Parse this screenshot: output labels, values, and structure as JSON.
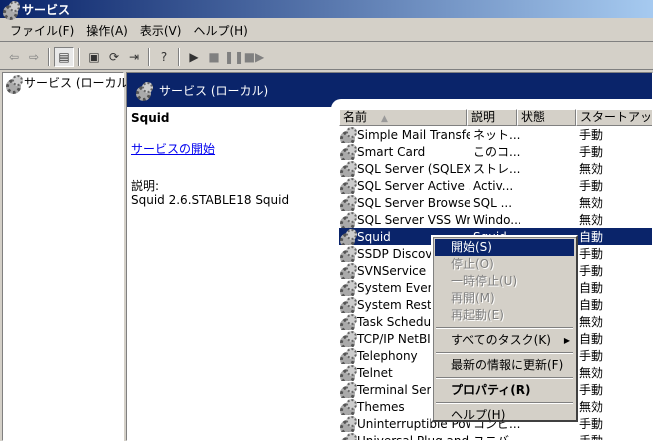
{
  "window": {
    "title": "サービス"
  },
  "menu": [
    "ファイル(F)",
    "操作(A)",
    "表示(V)",
    "ヘルプ(H)"
  ],
  "toolbar": {
    "back": "⇦",
    "forward": "⇨",
    "show_tree": "▤",
    "properties": "▣",
    "refresh": "⟳",
    "export": "⇥",
    "help": "?",
    "start": "▶",
    "stop": "■",
    "pause": "❚❚",
    "restart": "■▶"
  },
  "tree": {
    "root_label": "サービス (ローカル)"
  },
  "header": {
    "title": "サービス (ローカル)"
  },
  "detail": {
    "service_name": "Squid",
    "start_link": "サービスの開始",
    "description_label": "説明:",
    "description": "Squid 2.6.STABLE18 Squid"
  },
  "columns": {
    "name": "名前",
    "description": "説明",
    "status": "状態",
    "startup": "スタートアップの種"
  },
  "services": [
    {
      "name": "Simple Mail Transfe...",
      "description": "ネット...",
      "status": "",
      "startup": "手動"
    },
    {
      "name": "Smart Card",
      "description": "このコ...",
      "status": "",
      "startup": "手動"
    },
    {
      "name": "SQL Server (SQLEX...",
      "description": "ストレ...",
      "status": "",
      "startup": "無効"
    },
    {
      "name": "SQL Server Active ...",
      "description": "Activ...",
      "status": "",
      "startup": "手動"
    },
    {
      "name": "SQL Server Browser",
      "description": "SQL ...",
      "status": "",
      "startup": "無効"
    },
    {
      "name": "SQL Server VSS Wr...",
      "description": "Windo...",
      "status": "",
      "startup": "無効"
    },
    {
      "name": "Squid",
      "description": "Squid ...",
      "status": "",
      "startup": "自動"
    },
    {
      "name": "SSDP Discovery Service",
      "description": "",
      "status": "",
      "startup": "手動"
    },
    {
      "name": "SVNService",
      "description": "",
      "status": "",
      "startup": "手動"
    },
    {
      "name": "System Event Notification",
      "description": "",
      "status": "",
      "startup": "自動"
    },
    {
      "name": "System Restore Service",
      "description": "",
      "status": "",
      "startup": "自動"
    },
    {
      "name": "Task Scheduler",
      "description": "",
      "status": "",
      "startup": "無効"
    },
    {
      "name": "TCP/IP NetBIOS Helper",
      "description": "",
      "status": "",
      "startup": "自動"
    },
    {
      "name": "Telephony",
      "description": "",
      "status": "",
      "startup": "手動"
    },
    {
      "name": "Telnet",
      "description": "",
      "status": "",
      "startup": "無効"
    },
    {
      "name": "Terminal Services",
      "description": "",
      "status": "",
      "startup": "手動"
    },
    {
      "name": "Themes",
      "description": "",
      "status": "",
      "startup": "無効"
    },
    {
      "name": "Uninterruptible Pow...",
      "description": "コンピ...",
      "status": "",
      "startup": "手動"
    },
    {
      "name": "Universal Plug and ...",
      "description": "ユニバ...",
      "status": "",
      "startup": "手動"
    }
  ],
  "context_menu": {
    "start": "開始(S)",
    "stop": "停止(O)",
    "pause": "一時停止(U)",
    "resume": "再開(M)",
    "restart": "再起動(E)",
    "all_tasks": "すべてのタスク(K)",
    "refresh": "最新の情報に更新(F)",
    "properties": "プロパティ(R)",
    "help": "ヘルプ(H)"
  },
  "colors": {
    "selection": "#0a246a",
    "face": "#d4d0c8",
    "link": "#0000ee"
  }
}
